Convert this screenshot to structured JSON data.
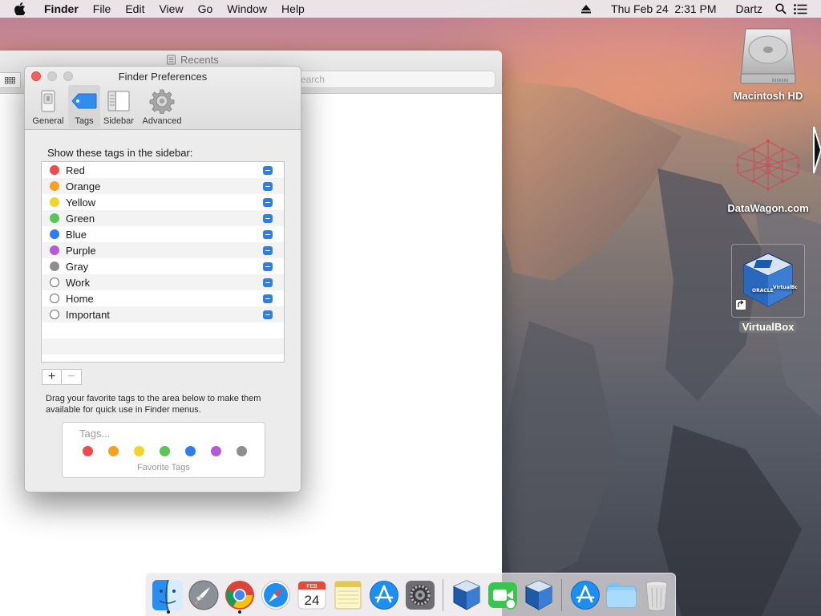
{
  "menubar": {
    "apple_icon": "apple-icon",
    "app_name": "Finder",
    "menus": [
      "File",
      "Edit",
      "View",
      "Go",
      "Window",
      "Help"
    ],
    "right": {
      "eject_icon": "eject-icon",
      "datetime": "Thu Feb 24  2:31 PM",
      "user": "Dartz",
      "search_icon": "spotlight-icon",
      "list_icon": "notification-center-icon"
    }
  },
  "finder_window": {
    "title": "Recents",
    "search_placeholder": "Search"
  },
  "prefs": {
    "title": "Finder Preferences",
    "tabs": [
      {
        "label": "General",
        "icon": "general-icon",
        "active": false
      },
      {
        "label": "Tags",
        "icon": "tag-icon",
        "active": true
      },
      {
        "label": "Sidebar",
        "icon": "sidebar-icon",
        "active": false
      },
      {
        "label": "Advanced",
        "icon": "gear-icon",
        "active": false
      }
    ],
    "heading": "Show these tags in the sidebar:",
    "tags": [
      {
        "label": "Red",
        "color": "#f04b4b"
      },
      {
        "label": "Orange",
        "color": "#f5a023"
      },
      {
        "label": "Yellow",
        "color": "#f6d32a"
      },
      {
        "label": "Green",
        "color": "#58c557"
      },
      {
        "label": "Blue",
        "color": "#2f7ef0"
      },
      {
        "label": "Purple",
        "color": "#b45ad6"
      },
      {
        "label": "Gray",
        "color": "#8e8e8e"
      },
      {
        "label": "Work",
        "color": ""
      },
      {
        "label": "Home",
        "color": ""
      },
      {
        "label": "Important",
        "color": ""
      }
    ],
    "add_label": "+",
    "remove_label": "−",
    "drag_text": "Drag your favorite tags to the area below to make them available for quick use in Finder menus.",
    "favorites": {
      "placeholder": "Tags...",
      "caption": "Favorite Tags",
      "colors": [
        "#f04b4b",
        "#f5a023",
        "#f6d32a",
        "#58c557",
        "#2f7ef0",
        "#b45ad6",
        "#8e8e8e"
      ]
    }
  },
  "desktop_icons": [
    {
      "label": "Macintosh HD",
      "icon": "hard-drive-icon"
    },
    {
      "label": "DataWagon.com",
      "icon": "datawagon-icon"
    },
    {
      "label": "VirtualBox",
      "icon": "virtualbox-icon"
    }
  ],
  "dock": {
    "apps": [
      {
        "name": "Finder",
        "icon": "finder-icon",
        "running": true
      },
      {
        "name": "Launchpad",
        "icon": "launchpad-icon",
        "running": false
      },
      {
        "name": "Chrome",
        "icon": "chrome-icon",
        "running": true
      },
      {
        "name": "Safari",
        "icon": "safari-icon",
        "running": false
      },
      {
        "name": "Calendar",
        "icon": "calendar-icon",
        "running": false,
        "month": "FEB",
        "day": "24"
      },
      {
        "name": "Notes",
        "icon": "notes-icon",
        "running": false
      },
      {
        "name": "App Store",
        "icon": "app-store-icon",
        "running": false
      },
      {
        "name": "System Preferences",
        "icon": "system-preferences-icon",
        "running": false
      },
      {
        "name": "VirtualBox",
        "icon": "virtualbox-icon",
        "running": false
      },
      {
        "name": "FaceTime",
        "icon": "facetime-icon",
        "running": false
      },
      {
        "name": "VirtualBox",
        "icon": "virtualbox-icon",
        "running": false
      },
      {
        "name": "App Store",
        "icon": "app-store-icon",
        "running": false
      },
      {
        "name": "Folder",
        "icon": "folder-icon",
        "running": false
      },
      {
        "name": "Trash",
        "icon": "trash-icon",
        "running": false
      }
    ]
  }
}
